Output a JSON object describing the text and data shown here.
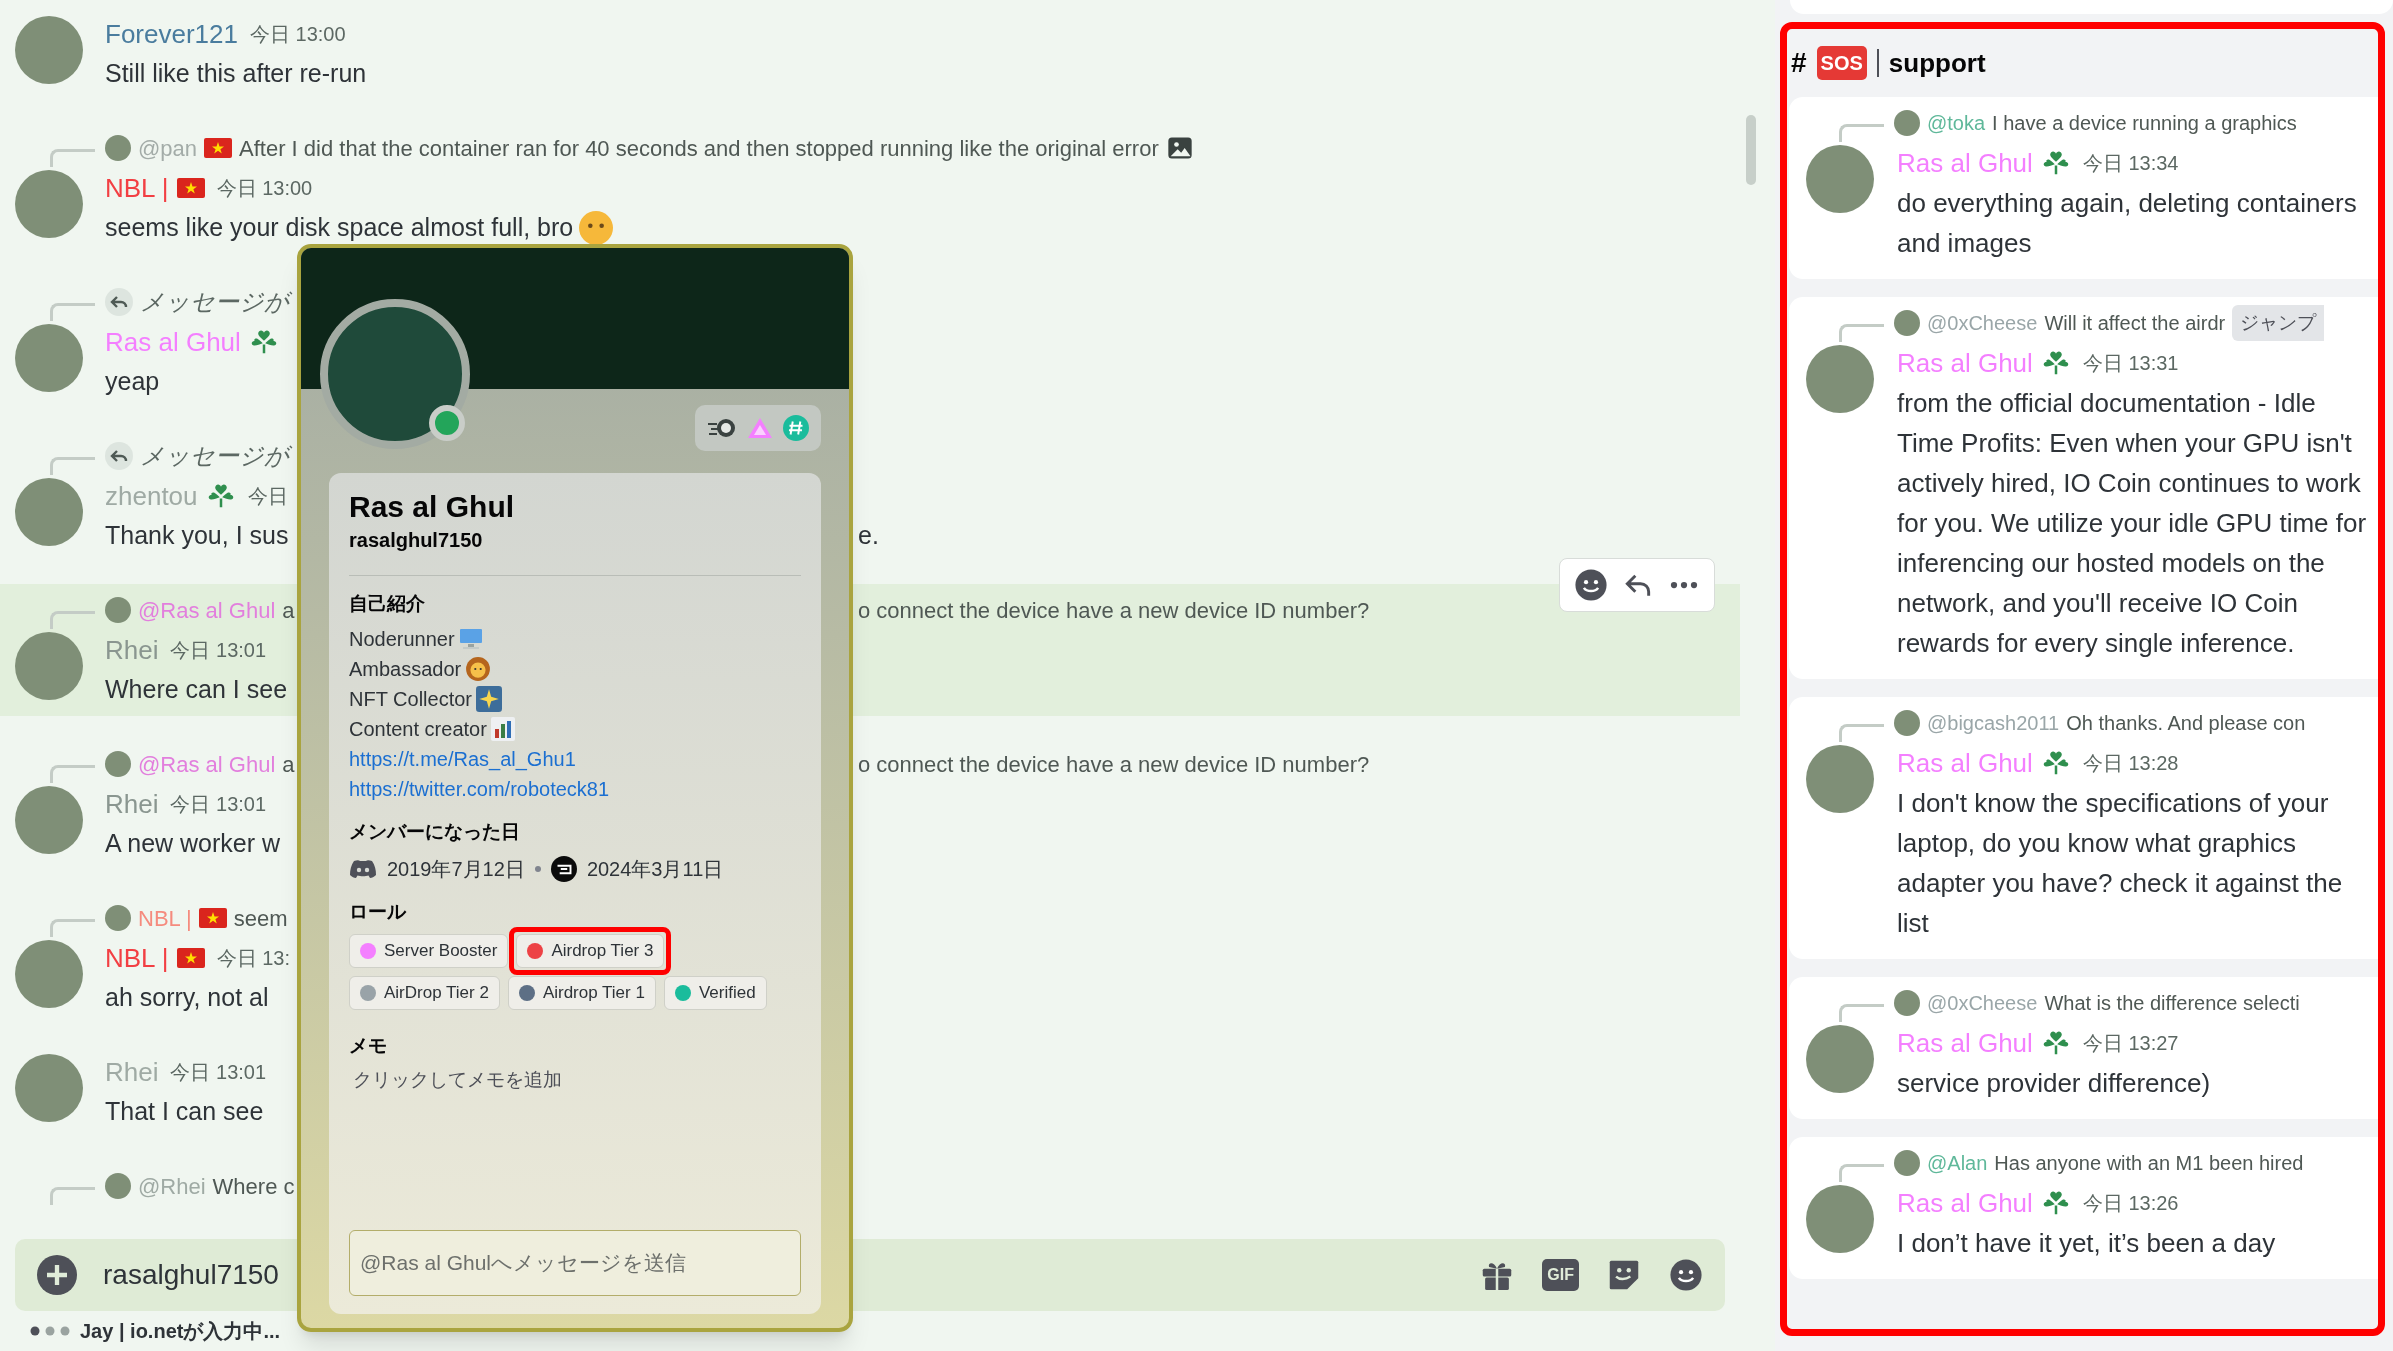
{
  "chat": {
    "messages": [
      {
        "author": "Forever121",
        "color": "#4a7c9e",
        "time": "今日 13:00",
        "text": "Still like this after re-run",
        "highlighted": false
      },
      {
        "reply": {
          "kind": "user",
          "mention": "@pan",
          "color": "#a3aca8",
          "flag": true,
          "text": "After I did that the container ran for 40 seconds and then stopped running like the original error",
          "attachment": true
        },
        "author": "NBL |",
        "flag": true,
        "color": "#f23f43",
        "time": "今日 13:00",
        "text": "seems like your disk space almost full, bro",
        "trailing_emoji": true,
        "highlighted": false
      },
      {
        "reply": {
          "kind": "unavailable",
          "text": "メッセージが"
        },
        "author": "Ras al Ghul",
        "role_icon": true,
        "color": "#f47fff",
        "text": "yeap",
        "highlighted": false
      },
      {
        "reply": {
          "kind": "unavailable",
          "text": "メッセージが"
        },
        "author": "zhentou",
        "role_icon": true,
        "color": "#9faaa4",
        "time": "今日",
        "text": "Thank you, I sus",
        "text_right": "e.",
        "highlighted": false
      },
      {
        "reply": {
          "kind": "user",
          "mention": "@Ras al Ghul",
          "color": "#e27fdd",
          "text": "a",
          "text_right": "o connect the device have a new device ID number?"
        },
        "author": "Rhei",
        "color": "#8a9690",
        "time": "今日 13:01",
        "text": "Where can I see",
        "highlighted": true
      },
      {
        "reply": {
          "kind": "user",
          "mention": "@Ras al Ghul",
          "color": "#e27fdd",
          "text": "a",
          "text_right": "o connect the device have a new device ID number?"
        },
        "author": "Rhei",
        "color": "#8a9690",
        "time": "今日 13:01",
        "text": "A new worker w",
        "highlighted": false
      },
      {
        "reply": {
          "kind": "user",
          "mention": "NBL |",
          "color": "#f58b7e",
          "flag": true,
          "text": "seem"
        },
        "author": "NBL |",
        "flag": true,
        "color": "#f23f43",
        "time": "今日 13:",
        "text": "ah sorry, not al",
        "highlighted": false
      },
      {
        "author": "Rhei",
        "color": "#9faaa4",
        "time": "今日 13:01",
        "text": "That I can see",
        "highlighted": false
      },
      {
        "reply": {
          "kind": "user",
          "mention": "@Rhei",
          "color": "#9faaa4",
          "text": "Where c"
        },
        "highlighted": false
      }
    ],
    "input": {
      "value": "rasalghul7150",
      "gif_label": "GIF"
    },
    "typing": "Jay | io.netが入力中..."
  },
  "profile": {
    "display_name": "Ras al Ghul",
    "username": "rasalghul7150",
    "online": true,
    "badges": [
      {
        "kind": "speed"
      },
      {
        "kind": "triangle"
      },
      {
        "kind": "hash"
      }
    ],
    "bio_heading": "自己紹介",
    "bio": [
      {
        "text": "Noderunner",
        "kind": "monitor"
      },
      {
        "text": "Ambassador",
        "kind": "lion"
      },
      {
        "text": "NFT Collector",
        "kind": "sparkle"
      },
      {
        "text": "Content creator",
        "kind": "chart"
      }
    ],
    "links": [
      "https://t.me/Ras_al_Ghu1",
      "https://twitter.com/roboteck81"
    ],
    "member_heading": "メンバーになった日",
    "discord_joined": "2019年7月12日",
    "server_joined": "2024年3月11日",
    "roles_heading": "ロール",
    "roles": [
      {
        "name": "Server Booster",
        "color": "#f47fff",
        "highlighted": false
      },
      {
        "name": "Airdrop Tier 3",
        "color": "#ed4245",
        "highlighted": true
      },
      {
        "name": "AirDrop Tier 2",
        "color": "#99a3a8",
        "highlighted": false
      },
      {
        "name": "Airdrop Tier 1",
        "color": "#5d6f85",
        "highlighted": false
      },
      {
        "name": "Verified",
        "color": "#1abc9c",
        "highlighted": false
      }
    ],
    "memo_heading": "メモ",
    "memo_placeholder": "クリックしてメモを追加",
    "message_placeholder": "@Ras al Ghulへメッセージを送信"
  },
  "thread_panel": {
    "highlighted": true,
    "hash": "#",
    "badge": "SOS",
    "channel": "support",
    "messages": [
      {
        "reply": {
          "mention": "@toka",
          "color": "#5fb89a",
          "text": "I have a device running a graphics"
        },
        "author": "Ras al Ghul",
        "time": "今日 13:34",
        "text": "do everything again, deleting containers and images"
      },
      {
        "reply": {
          "mention": "@0xCheese",
          "color": "#9aa6a8",
          "text": "Will it affect the airdr",
          "jump_label": "ジャンプ"
        },
        "author": "Ras al Ghul",
        "time": "今日 13:31",
        "text": "from the official documentation - Idle Time Profits: Even when your GPU isn't actively hired, IO Coin continues to work for you. We utilize your idle GPU time for inferencing our hosted models on the network, and you'll receive IO Coin rewards for every single inference."
      },
      {
        "reply": {
          "mention": "@bigcash2011",
          "color": "#9aa6a8",
          "text": "Oh thanks. And please con"
        },
        "author": "Ras al Ghul",
        "time": "今日 13:28",
        "text": "I don't know the specifications of your laptop, do you know what graphics adapter you have? check it against the list"
      },
      {
        "reply": {
          "mention": "@0xCheese",
          "color": "#9aa6a8",
          "text": "What is the difference selecti"
        },
        "author": "Ras al Ghul",
        "time": "今日 13:27",
        "text": "service provider difference)"
      },
      {
        "reply": {
          "mention": "@Alan",
          "color": "#5fb89a",
          "text": "Has anyone with an M1 been hired"
        },
        "author": "Ras al Ghul",
        "time": "今日 13:26",
        "text": "I don’t have it yet, it’s been a day"
      }
    ]
  }
}
